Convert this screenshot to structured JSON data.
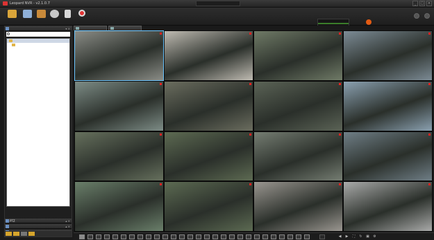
{
  "window": {
    "title": "Leopard NVR - v2.1.0.7",
    "center_title": ""
  },
  "toolbar": {
    "buttons": [
      {
        "label": "",
        "color": "#d9a53a"
      },
      {
        "label": "",
        "color": "#8fb0d8"
      },
      {
        "label": "",
        "color": "#c98a3a"
      },
      {
        "label": "",
        "color": "#c9c9c9"
      },
      {
        "label": "",
        "color": "#d8d8d8"
      },
      {
        "label": "",
        "color": "#e23333"
      }
    ]
  },
  "status": {
    "rows": [
      {
        "k": "",
        "v": ""
      },
      {
        "k": "",
        "v": ""
      },
      {
        "k": "",
        "v": ""
      }
    ]
  },
  "alarm": {
    "label": "",
    "lines": [
      "",
      "",
      ""
    ]
  },
  "sidebar": {
    "title": "",
    "search_placeholder": "",
    "tree": [
      {
        "label": "",
        "selected": true
      },
      {
        "label": "",
        "selected": false
      }
    ],
    "bottom_panels": [
      "PTZ",
      "",
      ""
    ]
  },
  "tabs": [
    {
      "label": ""
    },
    {
      "label": ""
    }
  ],
  "cameras": [
    {
      "label": "",
      "stamp": "",
      "bg": "#8a8c86"
    },
    {
      "label": "",
      "stamp": "",
      "bg": "#bfbbb2"
    },
    {
      "label": "",
      "stamp": "",
      "bg": "#6f7a66"
    },
    {
      "label": "",
      "stamp": "",
      "bg": "#7c8b95"
    },
    {
      "label": "",
      "stamp": "",
      "bg": "#7d8c86"
    },
    {
      "label": "",
      "stamp": "",
      "bg": "#6b6d5f"
    },
    {
      "label": "",
      "stamp": "",
      "bg": "#5b6356"
    },
    {
      "label": "",
      "stamp": "",
      "bg": "#8aa0b0"
    },
    {
      "label": "",
      "stamp": "",
      "bg": "#66705d"
    },
    {
      "label": "",
      "stamp": "",
      "bg": "#5d6a52"
    },
    {
      "label": "",
      "stamp": "",
      "bg": "#757d72"
    },
    {
      "label": "",
      "stamp": "",
      "bg": "#6f7e86"
    },
    {
      "label": "",
      "stamp": "",
      "bg": "#6a7f6a"
    },
    {
      "label": "",
      "stamp": "",
      "bg": "#5c6a52"
    },
    {
      "label": "",
      "stamp": "",
      "bg": "#9a9690"
    },
    {
      "label": "",
      "stamp": "",
      "bg": "#a9aaa9"
    }
  ],
  "bottombar": {
    "page_indicator": ""
  }
}
